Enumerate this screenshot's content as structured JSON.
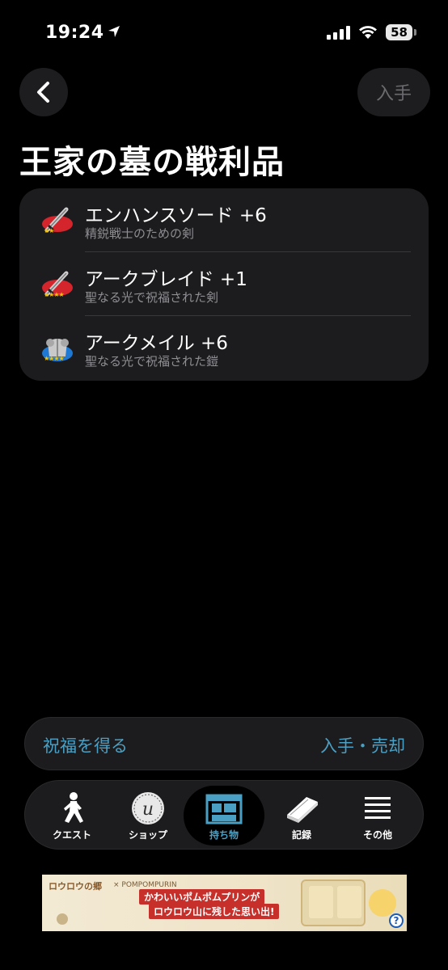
{
  "status": {
    "time": "19:24",
    "battery": "58"
  },
  "nav": {
    "acquire_label": "入手"
  },
  "title": "王家の墓の戦利品",
  "items": [
    {
      "name": "エンハンスソード +6",
      "desc": "精鋭戦士のための剣",
      "rarity": "★★",
      "icon": "sword-icon"
    },
    {
      "name": "アークブレイド +1",
      "desc": "聖なる光で祝福された剣",
      "rarity": "★★★★",
      "icon": "sword-icon"
    },
    {
      "name": "アークメイル +6",
      "desc": "聖なる光で祝福された鎧",
      "rarity": "★★★★",
      "icon": "armor-icon"
    }
  ],
  "actions": {
    "bless": "祝福を得る",
    "acquire_sell": "入手・売却"
  },
  "tabs": [
    {
      "label": "クエスト",
      "icon": "running-figure-icon"
    },
    {
      "label": "ショップ",
      "icon": "coin-icon"
    },
    {
      "label": "持ち物",
      "icon": "storage-icon",
      "active": true
    },
    {
      "label": "記録",
      "icon": "book-icon"
    },
    {
      "label": "その他",
      "icon": "menu-icon"
    }
  ],
  "ad": {
    "logo": "ロウロウの郷",
    "brand": "× POMPOMPURIN",
    "headline1": "かわいいポムポムプリンが",
    "headline2": "ロウロウ山に残した思い出!",
    "help": "?"
  },
  "colors": {
    "accent": "#4aa0c4",
    "card": "#1c1c1e",
    "rarity": "#f5c400",
    "ad_red": "#c72f2a"
  }
}
